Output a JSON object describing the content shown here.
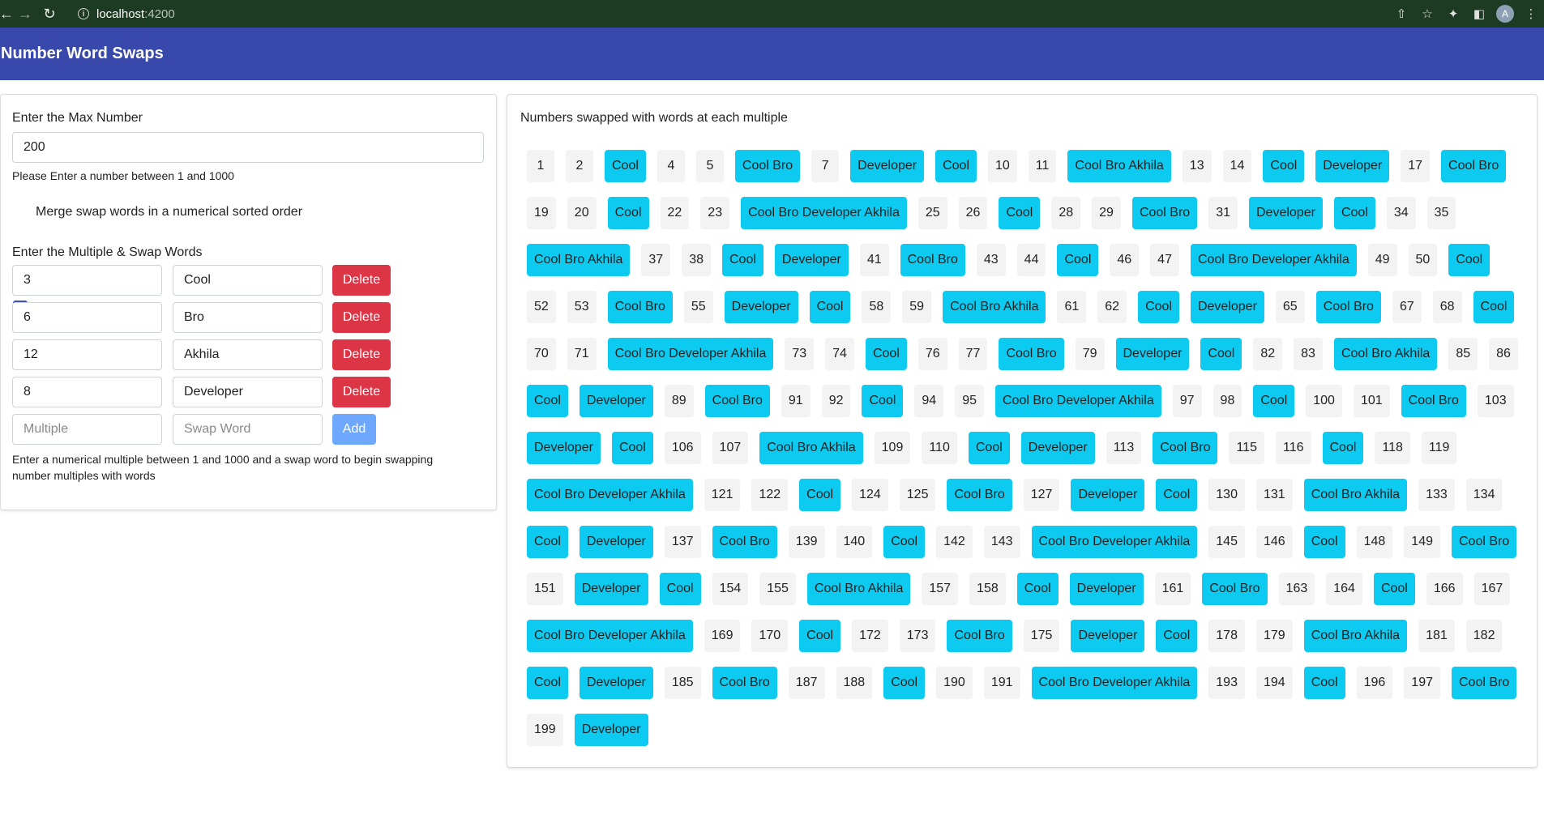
{
  "browser": {
    "url_host": "localhost",
    "url_port": ":4200",
    "avatar_letter": "A"
  },
  "app": {
    "title": "Number Word Swaps"
  },
  "form": {
    "max_label": "Enter the Max Number",
    "max_value": "200",
    "max_hint": "Please Enter a number between 1 and 1000",
    "merge_label": "Merge swap words in a numerical sorted order",
    "merge_checked": true,
    "multiples_label": "Enter the Multiple & Swap Words",
    "rows": [
      {
        "multiple": "3",
        "word": "Cool",
        "delete_label": "Delete"
      },
      {
        "multiple": "6",
        "word": "Bro",
        "delete_label": "Delete"
      },
      {
        "multiple": "12",
        "word": "Akhila",
        "delete_label": "Delete"
      },
      {
        "multiple": "8",
        "word": "Developer",
        "delete_label": "Delete"
      }
    ],
    "new_multiple_placeholder": "Multiple",
    "new_word_placeholder": "Swap Word",
    "add_label": "Add",
    "footer_hint": "Enter a numerical multiple between 1 and 1000 and a swap word to begin swapping number multiples with words"
  },
  "results": {
    "title": "Numbers swapped with words at each multiple",
    "items": [
      "1",
      "2",
      "Cool",
      "4",
      "5",
      "Cool Bro",
      "7",
      "Developer",
      "Cool",
      "10",
      "11",
      "Cool Bro Akhila",
      "13",
      "14",
      "Cool",
      "Developer",
      "17",
      "Cool Bro",
      "19",
      "20",
      "Cool",
      "22",
      "23",
      "Cool Bro Developer Akhila",
      "25",
      "26",
      "Cool",
      "28",
      "29",
      "Cool Bro",
      "31",
      "Developer",
      "Cool",
      "34",
      "35",
      "Cool Bro Akhila",
      "37",
      "38",
      "Cool",
      "Developer",
      "41",
      "Cool Bro",
      "43",
      "44",
      "Cool",
      "46",
      "47",
      "Cool Bro Developer Akhila",
      "49",
      "50",
      "Cool",
      "52",
      "53",
      "Cool Bro",
      "55",
      "Developer",
      "Cool",
      "58",
      "59",
      "Cool Bro Akhila",
      "61",
      "62",
      "Cool",
      "Developer",
      "65",
      "Cool Bro",
      "67",
      "68",
      "Cool",
      "70",
      "71",
      "Cool Bro Developer Akhila",
      "73",
      "74",
      "Cool",
      "76",
      "77",
      "Cool Bro",
      "79",
      "Developer",
      "Cool",
      "82",
      "83",
      "Cool Bro Akhila",
      "85",
      "86",
      "Cool",
      "Developer",
      "89",
      "Cool Bro",
      "91",
      "92",
      "Cool",
      "94",
      "95",
      "Cool Bro Developer Akhila",
      "97",
      "98",
      "Cool",
      "100",
      "101",
      "Cool Bro",
      "103",
      "Developer",
      "Cool",
      "106",
      "107",
      "Cool Bro Akhila",
      "109",
      "110",
      "Cool",
      "Developer",
      "113",
      "Cool Bro",
      "115",
      "116",
      "Cool",
      "118",
      "119",
      "Cool Bro Developer Akhila",
      "121",
      "122",
      "Cool",
      "124",
      "125",
      "Cool Bro",
      "127",
      "Developer",
      "Cool",
      "130",
      "131",
      "Cool Bro Akhila",
      "133",
      "134",
      "Cool",
      "Developer",
      "137",
      "Cool Bro",
      "139",
      "140",
      "Cool",
      "142",
      "143",
      "Cool Bro Developer Akhila",
      "145",
      "146",
      "Cool",
      "148",
      "149",
      "Cool Bro",
      "151",
      "Developer",
      "Cool",
      "154",
      "155",
      "Cool Bro Akhila",
      "157",
      "158",
      "Cool",
      "Developer",
      "161",
      "Cool Bro",
      "163",
      "164",
      "Cool",
      "166",
      "167",
      "Cool Bro Developer Akhila",
      "169",
      "170",
      "Cool",
      "172",
      "173",
      "Cool Bro",
      "175",
      "Developer",
      "Cool",
      "178",
      "179",
      "Cool Bro Akhila",
      "181",
      "182",
      "Cool",
      "Developer",
      "185",
      "Cool Bro",
      "187",
      "188",
      "Cool",
      "190",
      "191",
      "Cool Bro Developer Akhila",
      "193",
      "194",
      "Cool",
      "196",
      "197",
      "Cool Bro",
      "199",
      "Developer"
    ]
  },
  "colors": {
    "header": "#3949ab",
    "word_chip": "#0dcaf0",
    "number_chip": "#f3f3f3",
    "delete_button": "#dc3545",
    "add_button": "#6ea8fe"
  }
}
